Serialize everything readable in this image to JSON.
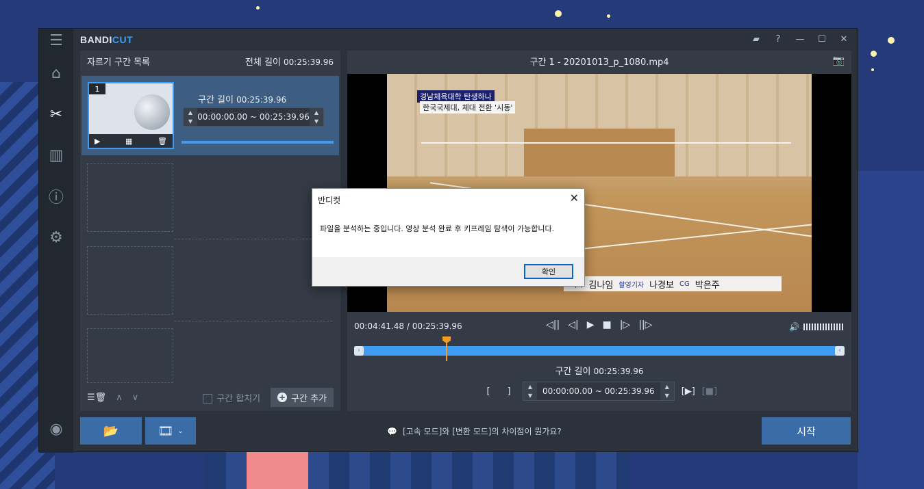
{
  "app": {
    "logo_part1": "BANDI",
    "logo_part2": "CUT",
    "window_buttons": [
      "folder-icon",
      "help-icon",
      "minimize-icon",
      "maximize-icon",
      "close-icon"
    ],
    "help_label": "?"
  },
  "sidebar": {
    "items": [
      "home-icon",
      "cut-icon",
      "join-icon",
      "info-icon",
      "settings-icon"
    ],
    "bottom": "record-icon"
  },
  "left_panel": {
    "title": "자르기 구간 목록",
    "total_label": "전체 길이",
    "total_value": "00:25:39.96",
    "segment": {
      "number": "1",
      "length_label": "구간 길이",
      "length_value": "00:25:39.96",
      "range_start": "00:00:00.00",
      "range_sep": "~",
      "range_end": "00:25:39.96"
    },
    "merge_label": "구간 합치기",
    "add_label": "구간 추가"
  },
  "right_panel": {
    "title": "구간 1 - 20201013_p_1080.mp4",
    "caption_line1": "경남체육대학 탄생하나",
    "caption_line2": "한국국제대, 체대 전환 '시동'",
    "credits": {
      "role1": "기자",
      "name1": "김나임",
      "role2": "촬영기자",
      "name2": "나경보",
      "role3": "CG",
      "name3": "박은주"
    },
    "current_time": "00:04:41.48",
    "time_sep": "/",
    "total_time": "00:25:39.96",
    "playhead_fraction": 0.183,
    "selection_length_label": "구간 길이",
    "selection_length_value": "00:25:39.96",
    "sel_start": "00:00:00.00",
    "sel_sep": "~",
    "sel_end": "00:25:39.96",
    "volume_level": 0.3
  },
  "bottom": {
    "tip": "[고속 모드]와 [변환 모드]의 차이점이 뭔가요?",
    "start_label": "시작"
  },
  "dialog": {
    "title": "반디컷",
    "message": "파일을 분석하는 중입니다. 영상 분석 완료 후 키프레임 탐색이 가능합니다.",
    "ok_label": "확인"
  },
  "colors": {
    "accent": "#3f9cf2",
    "playhead": "#f39c1f",
    "button": "#3a6da8"
  }
}
